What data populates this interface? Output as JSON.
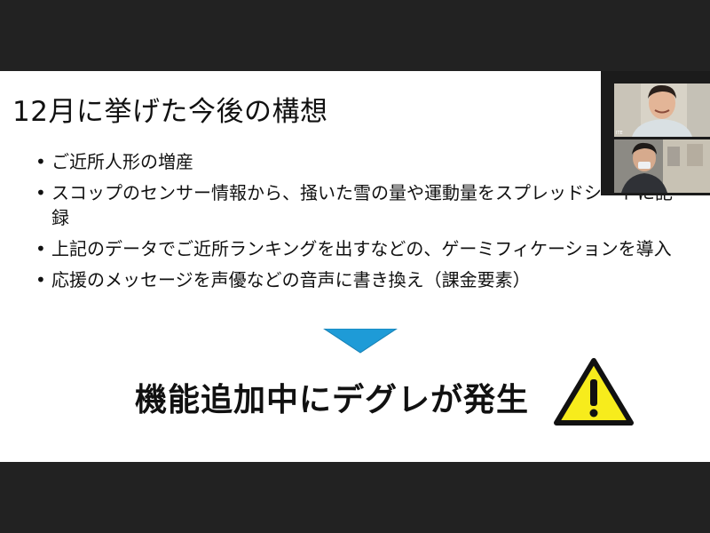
{
  "slide": {
    "title": "12月に挙げた今後の構想",
    "bullets": [
      "ご近所人形の増産",
      "スコップのセンサー情報から、掻いた雪の量や運動量をスプレッドシートに記録",
      "上記のデータでご近所ランキングを出すなどの、ゲーミフィケーションを導入",
      "応援のメッセージを声優などの音声に書き換え（課金要素）"
    ],
    "conclusion": "機能追加中にデグレが発生",
    "colors": {
      "arrow": "#1e9bd7",
      "warning_fill": "#f7ec1c",
      "warning_stroke": "#111111"
    }
  },
  "video_panel": {
    "participants": [
      {
        "name": "ITE",
        "icon": "person-video"
      },
      {
        "name": "",
        "icon": "person-video"
      }
    ]
  }
}
